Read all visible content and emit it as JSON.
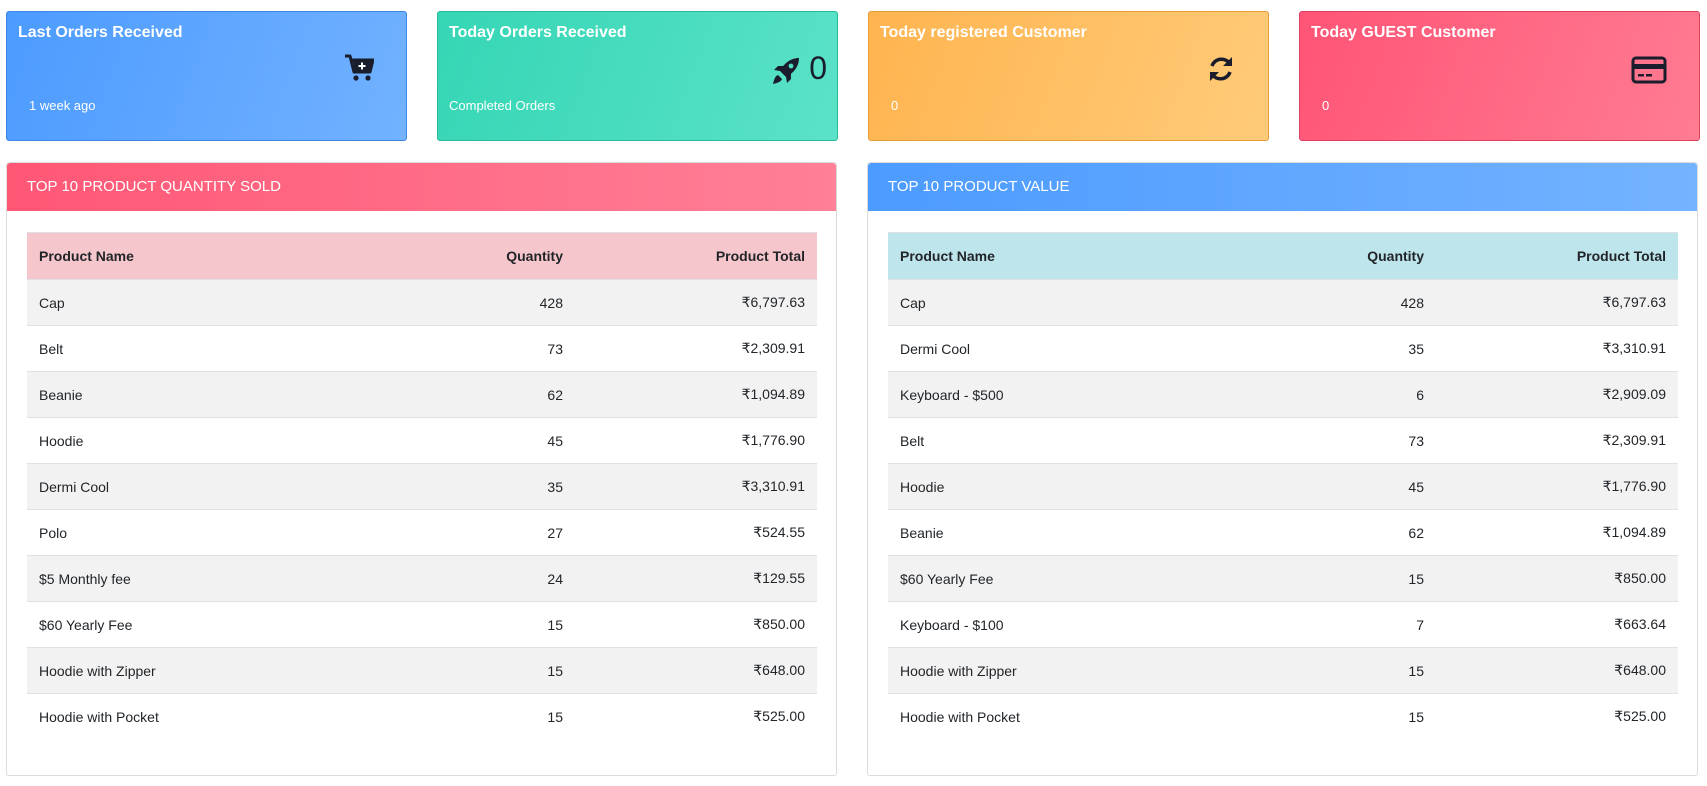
{
  "cards": [
    {
      "title": "Last Orders Received",
      "subtitle": "1 week ago",
      "icon": "cart-plus-icon"
    },
    {
      "title": "Today Orders Received",
      "subtitle": "Completed Orders",
      "count": "0",
      "icon": "rocket-icon"
    },
    {
      "title": "Today registered Customer",
      "subtitle": "0",
      "icon": "refresh-icon"
    },
    {
      "title": "Today GUEST Customer",
      "subtitle": "0",
      "icon": "credit-card-icon"
    }
  ],
  "quantity_panel": {
    "title": "TOP 10 PRODUCT QUANTITY SOLD",
    "columns": [
      "Product Name",
      "Quantity",
      "Product Total"
    ],
    "rows": [
      [
        "Cap",
        "428",
        "₹6,797.63"
      ],
      [
        "Belt",
        "73",
        "₹2,309.91"
      ],
      [
        "Beanie",
        "62",
        "₹1,094.89"
      ],
      [
        "Hoodie",
        "45",
        "₹1,776.90"
      ],
      [
        "Dermi Cool",
        "35",
        "₹3,310.91"
      ],
      [
        "Polo",
        "27",
        "₹524.55"
      ],
      [
        "$5 Monthly fee",
        "24",
        "₹129.55"
      ],
      [
        "$60 Yearly Fee",
        "15",
        "₹850.00"
      ],
      [
        "Hoodie with Zipper",
        "15",
        "₹648.00"
      ],
      [
        "Hoodie with Pocket",
        "15",
        "₹525.00"
      ]
    ]
  },
  "value_panel": {
    "title": "TOP 10 PRODUCT VALUE",
    "columns": [
      "Product Name",
      "Quantity",
      "Product Total"
    ],
    "rows": [
      [
        "Cap",
        "428",
        "₹6,797.63"
      ],
      [
        "Dermi Cool",
        "35",
        "₹3,310.91"
      ],
      [
        "Keyboard - $500",
        "6",
        "₹2,909.09"
      ],
      [
        "Belt",
        "73",
        "₹2,309.91"
      ],
      [
        "Hoodie",
        "45",
        "₹1,776.90"
      ],
      [
        "Beanie",
        "62",
        "₹1,094.89"
      ],
      [
        "$60 Yearly Fee",
        "15",
        "₹850.00"
      ],
      [
        "Keyboard - $100",
        "7",
        "₹663.64"
      ],
      [
        "Hoodie with Zipper",
        "15",
        "₹648.00"
      ],
      [
        "Hoodie with Pocket",
        "15",
        "₹525.00"
      ]
    ]
  }
}
